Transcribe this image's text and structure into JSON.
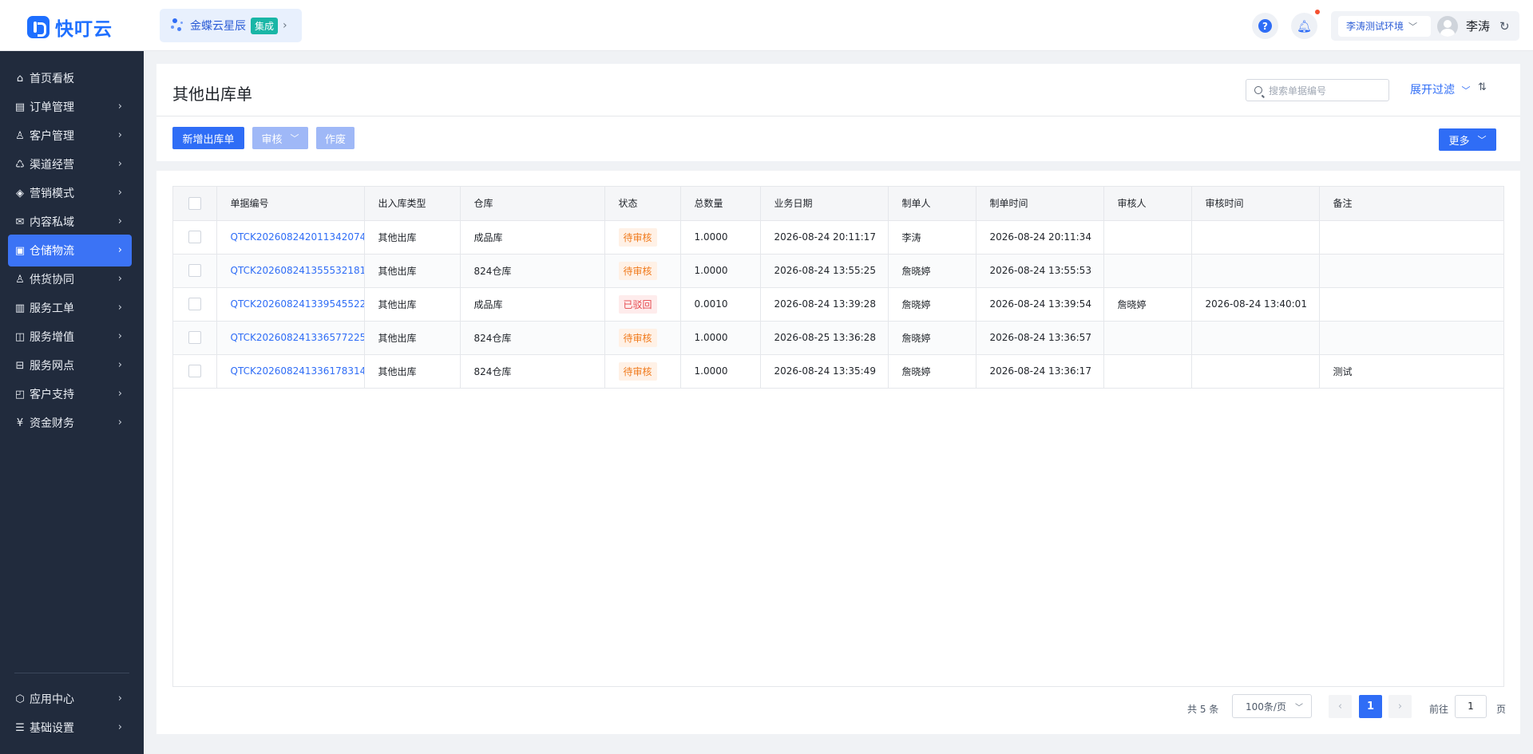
{
  "app": {
    "name": "快叮云"
  },
  "integration": {
    "name": "金蝶云星辰",
    "badge": "集成"
  },
  "topbar": {
    "help_glyph": "?",
    "environment": "李涛测试环境",
    "user_name": "李涛"
  },
  "sidebar": {
    "items": [
      {
        "label": "首页看板",
        "icon": "home-icon"
      },
      {
        "label": "订单管理",
        "icon": "order-icon"
      },
      {
        "label": "客户管理",
        "icon": "user-icon"
      },
      {
        "label": "渠道经营",
        "icon": "channel-icon"
      },
      {
        "label": "营销模式",
        "icon": "tag-icon"
      },
      {
        "label": "内容私域",
        "icon": "mail-icon"
      },
      {
        "label": "仓储物流",
        "icon": "warehouse-icon",
        "active": true
      },
      {
        "label": "供货协同",
        "icon": "supply-icon"
      },
      {
        "label": "服务工单",
        "icon": "ticket-icon"
      },
      {
        "label": "服务增值",
        "icon": "bag-icon"
      },
      {
        "label": "服务网点",
        "icon": "store-icon"
      },
      {
        "label": "客户支持",
        "icon": "support-icon"
      },
      {
        "label": "资金财务",
        "icon": "yuan-icon"
      }
    ],
    "bottom_items": [
      {
        "label": "应用中心",
        "icon": "cube-icon"
      },
      {
        "label": "基础设置",
        "icon": "settings-list-icon"
      }
    ]
  },
  "page": {
    "title": "其他出库单",
    "search_placeholder": "搜索单据编号",
    "filter_label": "展开过滤"
  },
  "toolbar": {
    "add_label": "新增出库单",
    "audit_label": "审核",
    "void_label": "作废",
    "more_label": "更多"
  },
  "table": {
    "columns": [
      "单据编号",
      "出入库类型",
      "仓库",
      "状态",
      "总数量",
      "业务日期",
      "制单人",
      "制单时间",
      "审核人",
      "审核时间",
      "备注"
    ],
    "rows": [
      {
        "id": "QTCK202608242011342074",
        "type": "其他出库",
        "warehouse": "成品库",
        "status": "待审核",
        "status_kind": "pending",
        "qty": "1.0000",
        "biz_date": "2026-08-24 20:11:17",
        "creator": "李涛",
        "created": "2026-08-24 20:11:34",
        "auditor": "",
        "audited": "",
        "remark": ""
      },
      {
        "id": "QTCK202608241355532181",
        "type": "其他出库",
        "warehouse": "824仓库",
        "status": "待审核",
        "status_kind": "pending",
        "qty": "1.0000",
        "biz_date": "2026-08-24 13:55:25",
        "creator": "詹晓婷",
        "created": "2026-08-24 13:55:53",
        "auditor": "",
        "audited": "",
        "remark": ""
      },
      {
        "id": "QTCK202608241339545522",
        "type": "其他出库",
        "warehouse": "成品库",
        "status": "已驳回",
        "status_kind": "rejected",
        "qty": "0.0010",
        "biz_date": "2026-08-24 13:39:28",
        "creator": "詹晓婷",
        "created": "2026-08-24 13:39:54",
        "auditor": "詹晓婷",
        "audited": "2026-08-24 13:40:01",
        "remark": ""
      },
      {
        "id": "QTCK202608241336577225",
        "type": "其他出库",
        "warehouse": "824仓库",
        "status": "待审核",
        "status_kind": "pending",
        "qty": "1.0000",
        "biz_date": "2026-08-25 13:36:28",
        "creator": "詹晓婷",
        "created": "2026-08-24 13:36:57",
        "auditor": "",
        "audited": "",
        "remark": ""
      },
      {
        "id": "QTCK202608241336178314",
        "type": "其他出库",
        "warehouse": "824仓库",
        "status": "待审核",
        "status_kind": "pending",
        "qty": "1.0000",
        "biz_date": "2026-08-24 13:35:49",
        "creator": "詹晓婷",
        "created": "2026-08-24 13:36:17",
        "auditor": "",
        "audited": "",
        "remark": "测试"
      }
    ]
  },
  "pagination": {
    "total_text": "共 5 条",
    "page_size": "100条/页",
    "current_page": "1",
    "goto_label": "前往",
    "goto_value": "1",
    "goto_suffix": "页"
  },
  "colors": {
    "brand": "#1e6fff",
    "primary": "#2f6df6",
    "sidebar_bg": "#212b3d",
    "pending": "#f07a1c",
    "rejected": "#e5484d"
  }
}
